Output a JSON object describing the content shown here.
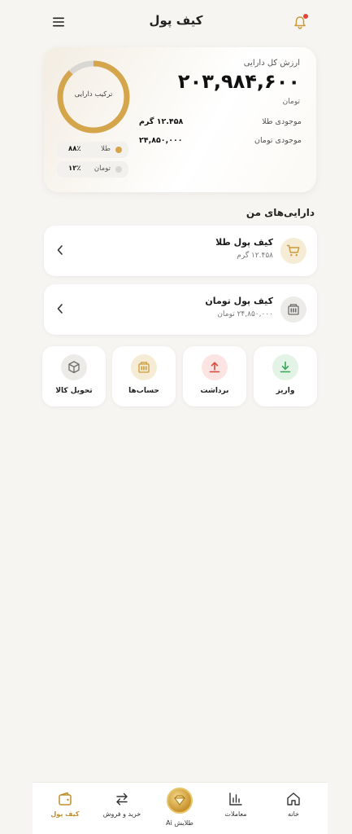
{
  "header": {
    "title": "کیف پول"
  },
  "summary": {
    "total_label": "ارزش کل دارایی",
    "total_value": "۲۰۳,۹۸۴,۶۰۰",
    "total_unit": "تومان",
    "gold_balance_label": "موجودی طلا",
    "gold_balance_value": "۱۲.۴۵۸ گرم",
    "toman_balance_label": "موجودی تومان",
    "toman_balance_value": "۲۴,۸۵۰,۰۰۰",
    "donut_label": "ترکیب دارایی",
    "composition": [
      {
        "name": "طلا",
        "value_text": "۸۸٪",
        "fraction": 0.88,
        "color": "#d4a54a"
      },
      {
        "name": "تومان",
        "value_text": "۱۲٪",
        "fraction": 0.12,
        "color": "#d9d7d3"
      }
    ]
  },
  "assets": {
    "title": "دارایی‌های من",
    "wallets": [
      {
        "title": "کیف پول طلا",
        "subtitle": "۱۲.۴۵۸ گرم",
        "icon": "cart-icon",
        "icon_bg": "#f6ecd6",
        "icon_color": "#c99a3a"
      },
      {
        "title": "کیف پول تومان",
        "subtitle": "۲۴,۸۵۰,۰۰۰ تومان",
        "icon": "bank-icon",
        "icon_bg": "#ecebe8",
        "icon_color": "#6b6b6b"
      }
    ]
  },
  "actions": [
    {
      "label": "واریز",
      "icon": "deposit-icon",
      "bg": "#e3f3e6",
      "color": "#3aa65a"
    },
    {
      "label": "برداشت",
      "icon": "withdraw-icon",
      "bg": "#fbe4e1",
      "color": "#d9473a"
    },
    {
      "label": "حساب‌ها",
      "icon": "accounts-icon",
      "bg": "#f6ecd6",
      "color": "#c99a3a"
    },
    {
      "label": "تحویل کالا",
      "icon": "package-icon",
      "bg": "#ecebe8",
      "color": "#6b6b6b"
    }
  ],
  "nav": {
    "home": "خانه",
    "transactions": "معاملات",
    "ai": "طلایش Ai",
    "trade": "خرید و فروش",
    "wallet": "کیف پول"
  },
  "colors": {
    "accent": "#c08f2a",
    "gold": "#d4a54a"
  }
}
